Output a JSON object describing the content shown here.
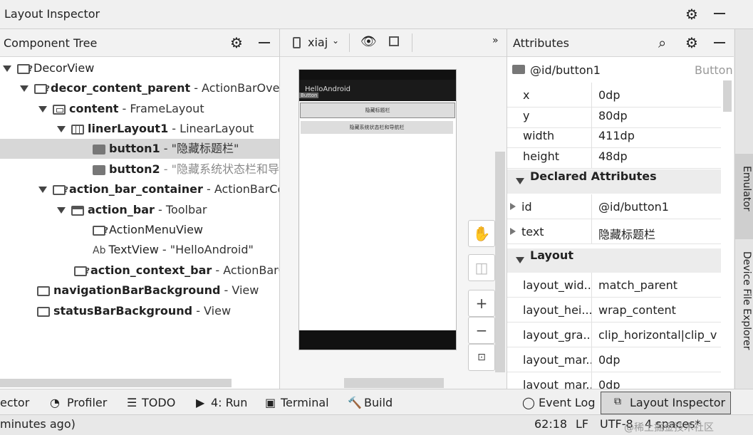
{
  "window": {
    "title": "Layout Inspector"
  },
  "tree": {
    "title": "Component Tree",
    "rows": [
      {
        "name": "DecorView",
        "type": ""
      },
      {
        "name": "decor_content_parent",
        "type": " - ActionBarOverla"
      },
      {
        "name": "content",
        "type": " - FrameLayout"
      },
      {
        "name": "linerLayout1",
        "type": " - LinearLayout"
      },
      {
        "name": "button1",
        "type": " - \"隐藏标题栏\""
      },
      {
        "name": "button2",
        "type": " - \"隐藏系统状态栏和导航"
      },
      {
        "name": "action_bar_container",
        "type": " - ActionBarCon"
      },
      {
        "name": "action_bar",
        "type": " - Toolbar"
      },
      {
        "name": "ActionMenuView",
        "type": ""
      },
      {
        "name": "TextView",
        "type": " - \"HelloAndroid\""
      },
      {
        "name": "action_context_bar",
        "type": " - ActionBarCo"
      },
      {
        "name": "navigationBarBackground",
        "type": " - View"
      },
      {
        "name": "statusBarBackground",
        "type": " - View"
      }
    ]
  },
  "preview": {
    "device_label": "xiaj",
    "chevron": "»",
    "app_title": "HelloAndroid",
    "button_tag": "Button",
    "button1_text": "隐藏标题栏",
    "button2_text": "隐藏系统状态栏和导航栏",
    "zoom_in": "+",
    "zoom_out": "−"
  },
  "attributes": {
    "title": "Attributes",
    "selected_id": "@id/button1",
    "selected_type": "Button",
    "basic": [
      {
        "key": "x",
        "value": "0dp"
      },
      {
        "key": "y",
        "value": "80dp"
      },
      {
        "key": "width",
        "value": "411dp"
      },
      {
        "key": "height",
        "value": "48dp"
      }
    ],
    "declared_title": "Declared Attributes",
    "declared": [
      {
        "key": "id",
        "value": "@id/button1"
      },
      {
        "key": "text",
        "value": "隐藏标题栏"
      }
    ],
    "layout_title": "Layout",
    "layout": [
      {
        "key": "layout_wid...",
        "value": "match_parent"
      },
      {
        "key": "layout_hei...",
        "value": "wrap_content"
      },
      {
        "key": "layout_gra...",
        "value": "clip_horizontal|clip_v"
      },
      {
        "key": "layout_mar...",
        "value": "0dp"
      },
      {
        "key": "layout_mar...",
        "value": "0dp"
      }
    ]
  },
  "side_tabs": {
    "emulator": "Emulator",
    "device_file_explorer": "Device File Explorer"
  },
  "bottom_tools": {
    "inspector_partial": "ector",
    "profiler": "Profiler",
    "todo": "TODO",
    "run": "4: Run",
    "terminal": "Terminal",
    "build": "Build",
    "event_log": "Event Log",
    "layout_inspector": "Layout Inspector"
  },
  "status_bar": {
    "message": "minutes ago)",
    "position": "62:18",
    "line_sep": "LF",
    "encoding": "UTF-8",
    "indent": "4 spaces*"
  },
  "watermark": "@稀土掘金技术社区"
}
